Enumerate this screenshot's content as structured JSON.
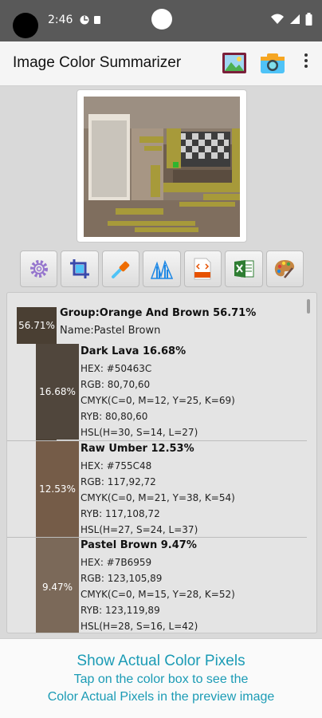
{
  "status_bar": {
    "time": "2:46"
  },
  "app_bar": {
    "title": "Image Color Summarizer"
  },
  "group": {
    "percent": "56.71%",
    "title": "Group:Orange And Brown 56.71%",
    "name": "Name:Pastel Brown",
    "color": "#4a3f33"
  },
  "colors": [
    {
      "percent": "16.68%",
      "title": "Dark Lava 16.68%",
      "hex": "HEX: #50463C",
      "rgb": "RGB: 80,70,60",
      "cmyk": "CMYK(C=0, M=12, Y=25, K=69)",
      "ryb": "RYB: 80,80,60",
      "hsl": "HSL(H=30, S=14, L=27)",
      "color": "#50463C"
    },
    {
      "percent": "12.53%",
      "title": "Raw Umber 12.53%",
      "hex": "HEX: #755C48",
      "rgb": "RGB: 117,92,72",
      "cmyk": "CMYK(C=0, M=21, Y=38, K=54)",
      "ryb": "RYB: 117,108,72",
      "hsl": "HSL(H=27, S=24, L=37)",
      "color": "#755C48"
    },
    {
      "percent": "9.47%",
      "title": "Pastel Brown 9.47%",
      "hex": "HEX: #7B6959",
      "rgb": "RGB: 123,105,89",
      "cmyk": "CMYK(C=0, M=15, Y=28, K=52)",
      "ryb": "RYB: 123,119,89",
      "hsl": "HSL(H=28, S=16, L=42)",
      "color": "#7B6959"
    }
  ],
  "footer": {
    "title": "Show Actual Color Pixels",
    "line1": "Tap on the color box to see the",
    "line2": "Color Actual Pixels in the preview image"
  }
}
